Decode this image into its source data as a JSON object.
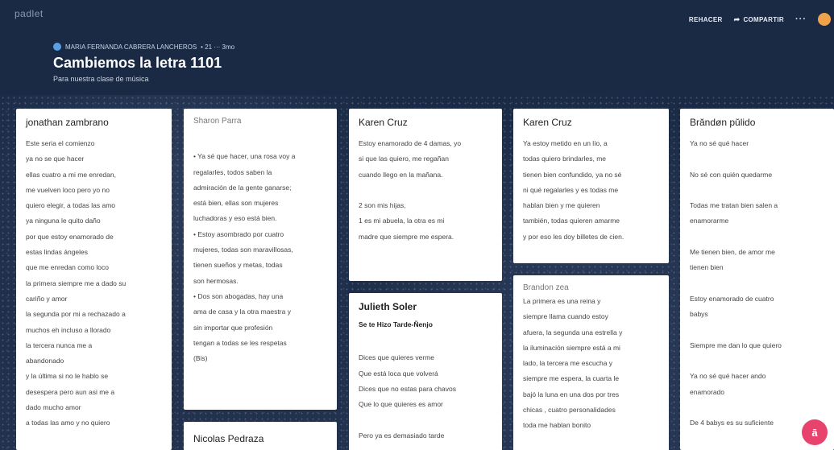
{
  "header": {
    "brand": "padlet",
    "redo_label": "REHACER",
    "share_label": "COMPARTIR",
    "more_label": "···",
    "author": "MARIA FERNANDA CABRERA LANCHEROS",
    "meta_rest": "• 21 ··· 3mo",
    "title": "Cambiemos la letra 1101",
    "subtitle": "Para nuestra clase de música"
  },
  "cards": {
    "c1": {
      "author": "jonathan zambrano",
      "lines": [
        "Este seria el comienzo",
        "ya no se que hacer",
        "ellas cuatro a mi me enredan,",
        "me vuelven loco pero yo no",
        "quiero elegir, a todas las amo",
        " ya ninguna le quito daño",
        "por que estoy enamorado de",
        "estas lindas ángeles",
        "que me enredan como loco",
        "la primera siempre me a dado su",
        "cariño y amor",
        "la segunda por mi a rechazado a",
        "muchos eh incluso a llorado",
        "la tercera nunca me a",
        "abandonado",
        "y la última si no le hablo se",
        "desespera pero aun asi me a",
        "dado mucho amor",
        "a todas las amo y no quiero"
      ]
    },
    "c2": {
      "author": "Sharon Parra",
      "lines": [
        "",
        "• Ya sé que hacer, una rosa voy a",
        "regalarles, todos saben la",
        "admiración de la gente ganarse;",
        "está bien, ellas son mujeres",
        "luchadoras y eso está bien.",
        " • Estoy asombrado por cuatro",
        "mujeres, todas son maravillosas,",
        "tienen sueños y metas, todas",
        "son hermosas.",
        " • Dos son abogadas, hay una",
        "ama de casa y la otra maestra y",
        "sin importar que profesión",
        "tengan a todas se les respetas",
        "(Bis)"
      ]
    },
    "c3": {
      "author": "Nicolas Pedraza"
    },
    "c4": {
      "author": "Karen Cruz",
      "lines": [
        "Estoy enamorado de 4 damas, yo",
        "si que las quiero, me regañan",
        "cuando llego en la mañana.",
        "",
        "2 son mis hijas,",
        "1 es mi abuela, la otra es mi",
        "madre que siempre me espera."
      ]
    },
    "c5": {
      "author": "Julieth Soler",
      "subtitle": "Se te Hizo Tarde-Ñenjo",
      "lines": [
        "",
        " Dices que quieres verme",
        "Que está loca que volverá",
        "Dices que no estas para chavos",
        "Que lo que quieres es amor",
        "",
        "Pero ya es demasiado tarde"
      ]
    },
    "c6": {
      "author": "Karen Cruz",
      "lines": [
        "Ya estoy metido en un lío, a",
        "todas quiero brindarles, me",
        "tienen bien confundido, ya no sé",
        "ni qué regalarles y es todas me",
        "hablan bien y me quieren",
        "también, todas quieren amarme",
        "y por eso les doy billetes de cien."
      ]
    },
    "c7": {
      "author": "Brandon zea",
      "lines": [
        "La primera es una reina y",
        "siempre llama cuando estoy",
        "afuera, la segunda una estrella y",
        "la iluminación siempre está a mi",
        "lado, la tercera me escucha y",
        "siempre me espera, la cuarta le",
        "bajó la luna en una dos por tres",
        "chicas , cuatro personalidades",
        "toda me hablan bonito"
      ]
    },
    "c8": {
      "author": "Brăndøn pŭlido",
      "lines": [
        "Ya no sé qué hacer",
        "",
        "No sé con quién quedarme",
        "",
        "Todas me tratan bien salen a",
        "enamorarme",
        "",
        "Me tienen bien, de amor me",
        "tienen bien",
        "",
        "Estoy enamorado de cuatro",
        "babys",
        "",
        "Siempre me dan lo que quiero",
        "",
        "Ya no sé qué hacer ando",
        "enamorado",
        "",
        "De 4 babys es su suficiente"
      ]
    }
  },
  "fab_label": "ā",
  "colors": {
    "background": "#1a2a44",
    "card": "#ffffff",
    "fab": "#e8436d",
    "avatar": "#f0a24a"
  }
}
